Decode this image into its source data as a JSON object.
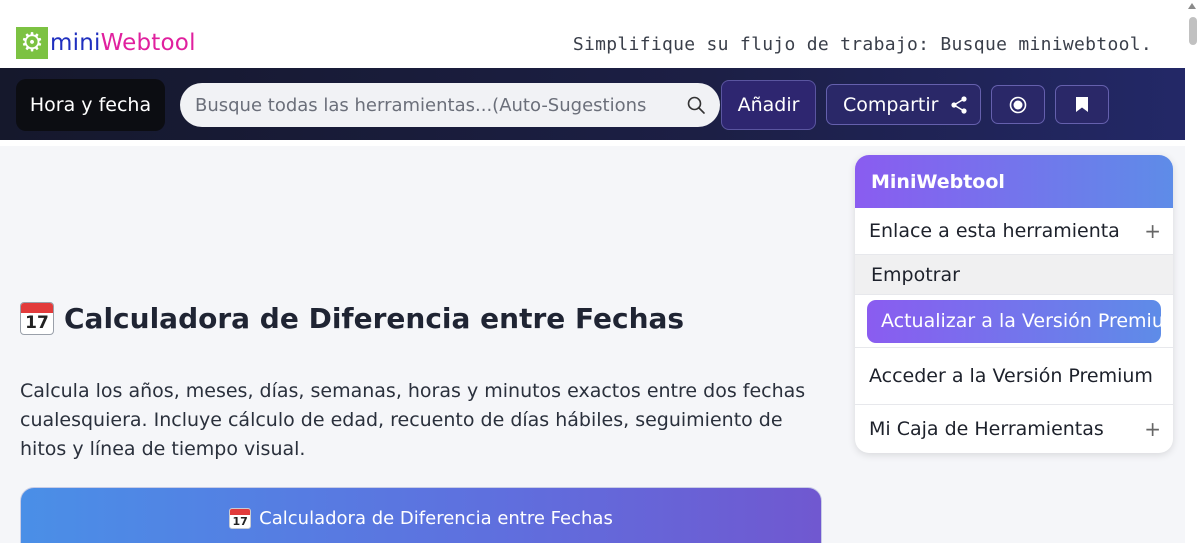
{
  "header": {
    "logo_mini": "mini",
    "logo_webtool": "Webtool",
    "tagline": "Simplifique su flujo de trabajo: Busque miniwebtool."
  },
  "navbar": {
    "category_label": "Hora y fecha",
    "search_placeholder": "Busque todas las herramientas...(Auto-Sugestions",
    "add_label": "Añadir",
    "share_label": "Compartir",
    "record_icon": "record-icon",
    "bookmark_icon": "bookmark-icon"
  },
  "main": {
    "title": "Calculadora de Diferencia entre Fechas",
    "calendar_day": "17",
    "description": "Calcula los años, meses, días, semanas, horas y minutos exactos entre dos fechas cualesquiera. Incluye cálculo de edad, recuento de días hábiles, seguimiento de hitos y línea de tiempo visual.",
    "card_title": "Calculadora de Diferencia entre Fechas"
  },
  "sidebar": {
    "title": "MiniWebtool",
    "link_label": "Enlace a esta herramienta",
    "embed_label": "Empotrar",
    "upgrade_label": "Actualizar a la Versión Premium",
    "access_label": "Acceder a la Versión Premium",
    "toolbox_label": "Mi Caja de Herramientas",
    "plus": "+"
  },
  "colors": {
    "brand_green": "#7cc242",
    "logo_blue": "#1f2fbf",
    "logo_pink": "#e0209e",
    "nav_dark": "#1c1f45",
    "accent_purple": "#8a5cf0",
    "accent_blue": "#5e8ce8"
  }
}
